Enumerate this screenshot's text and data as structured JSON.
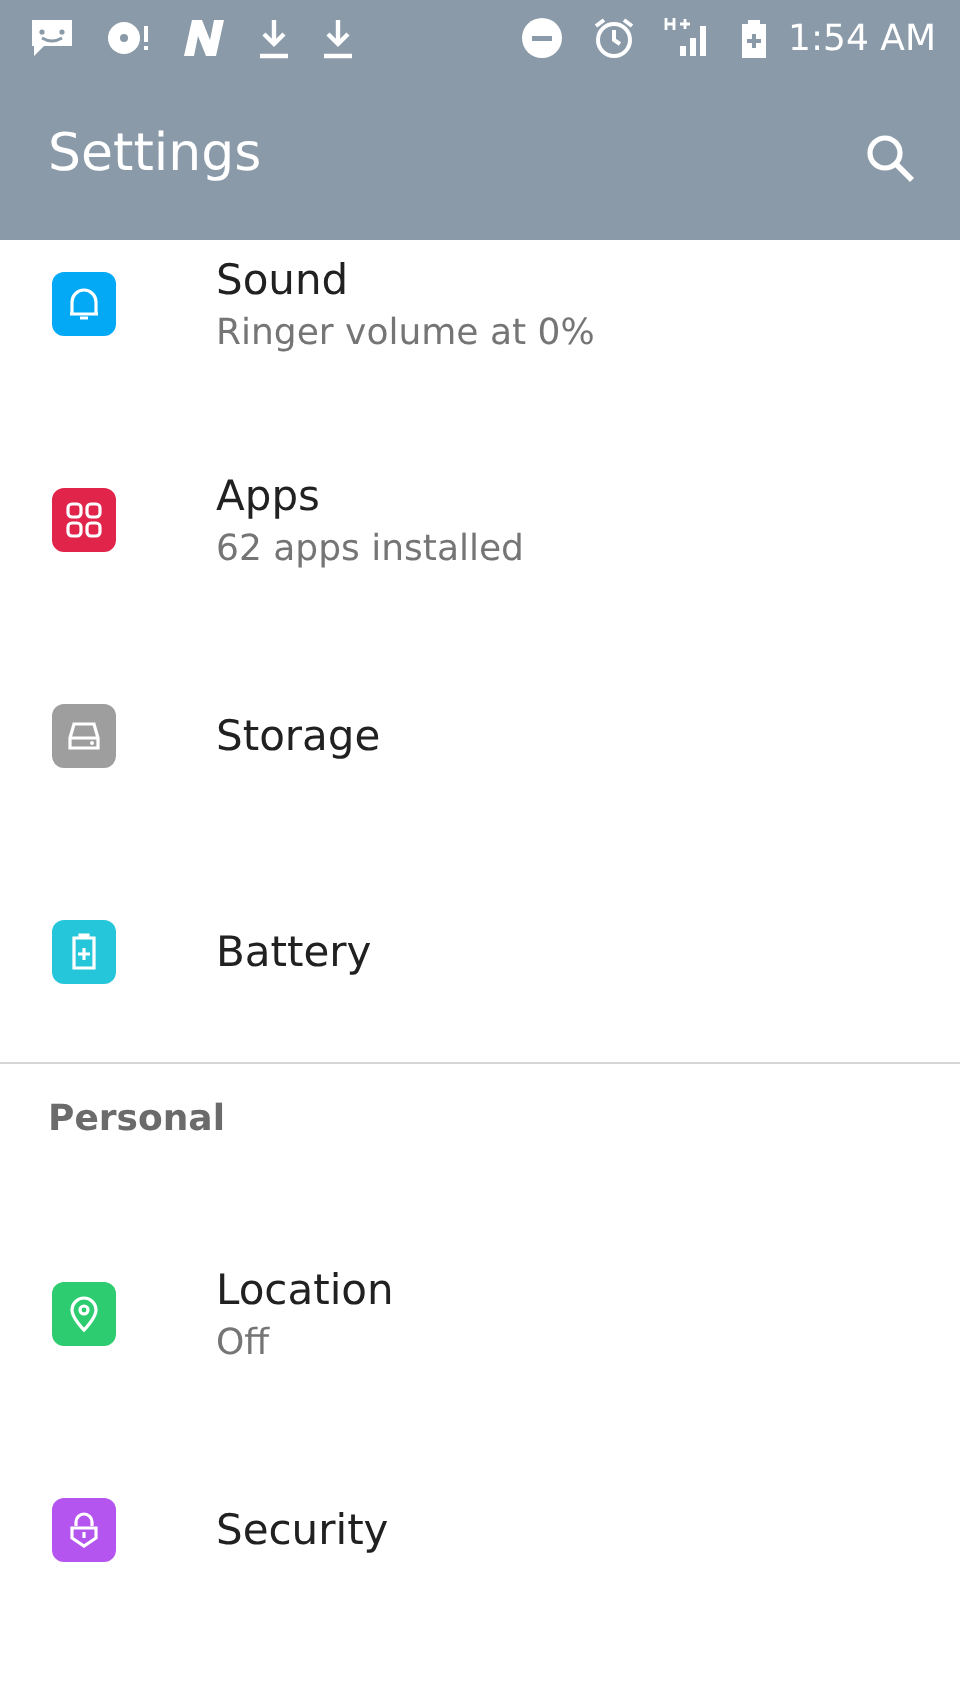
{
  "status_bar": {
    "time": "1:54 AM"
  },
  "app_bar": {
    "title": "Settings"
  },
  "sections": [
    {
      "items": [
        {
          "title": "Sound",
          "subtitle": "Ringer volume at 0%",
          "kind": "bell",
          "color": "#03a9f4"
        },
        {
          "title": "Apps",
          "subtitle": "62 apps installed",
          "kind": "grid",
          "color": "#e0244a"
        },
        {
          "title": "Storage",
          "kind": "drive",
          "color": "#9e9e9e"
        },
        {
          "title": "Battery",
          "kind": "battery",
          "color": "#26c6da"
        }
      ]
    },
    {
      "header": "Personal",
      "items": [
        {
          "title": "Location",
          "subtitle": "Off",
          "kind": "pin",
          "color": "#2ecc71"
        },
        {
          "title": "Security",
          "kind": "lock",
          "color": "#b455f0"
        }
      ]
    }
  ]
}
